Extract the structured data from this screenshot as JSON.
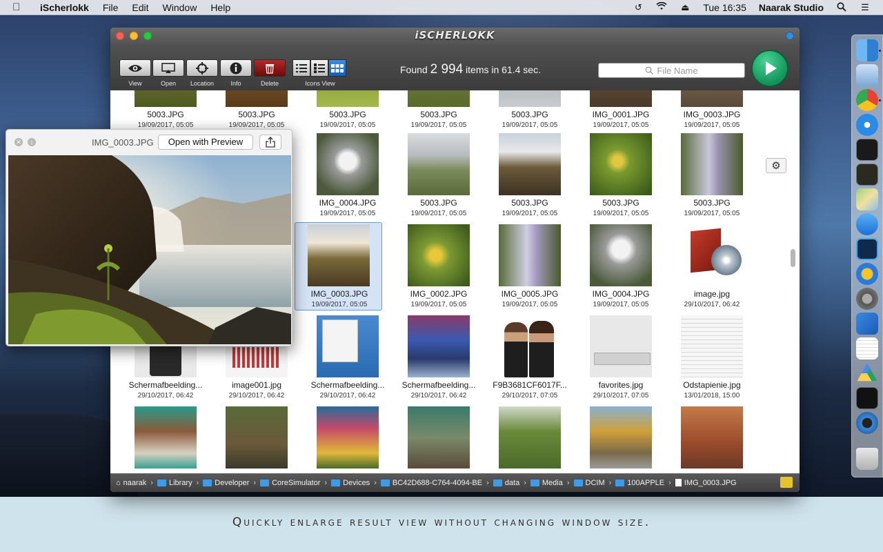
{
  "menubar": {
    "apple": "",
    "app_name": "iScherlokk",
    "items": [
      "File",
      "Edit",
      "Window",
      "Help"
    ],
    "clock": "Tue 16:35",
    "user": "Naarak Studio"
  },
  "window": {
    "logo": "iSCHERLOKK",
    "toolbar": {
      "view_label": "View",
      "open_label": "Open",
      "location_label": "Location",
      "info_label": "Info",
      "delete_label": "Delete",
      "icons_view_label": "Icons View"
    },
    "found_prefix": "Found",
    "found_count": "2 994",
    "found_suffix": "items in 61.4 sec.",
    "search_placeholder": "File Name"
  },
  "grid": {
    "row0": [
      {
        "name": "5003.JPG",
        "date": "19/09/2017, 05:05"
      },
      {
        "name": "5003.JPG",
        "date": "19/09/2017, 05:05"
      },
      {
        "name": "5003.JPG",
        "date": "19/09/2017, 05:05"
      },
      {
        "name": "5003.JPG",
        "date": "19/09/2017, 05:05"
      },
      {
        "name": "5003.JPG",
        "date": "19/09/2017, 05:05"
      },
      {
        "name": "IMG_0001.JPG",
        "date": "19/09/2017, 05:05"
      },
      {
        "name": "IMG_0003.JPG",
        "date": "19/09/2017, 05:05"
      }
    ],
    "row1": [
      {
        "name": "IMG_0004.JPG",
        "date": "19/09/2017, 05:05"
      },
      {
        "name": "5003.JPG",
        "date": "19/09/2017, 05:05"
      },
      {
        "name": "5003.JPG",
        "date": "19/09/2017, 05:05"
      },
      {
        "name": "5003.JPG",
        "date": "19/09/2017, 05:05"
      },
      {
        "name": "5003.JPG",
        "date": "19/09/2017, 05:05"
      }
    ],
    "row2": [
      {
        "name": "IMG_0003.JPG",
        "date": "19/09/2017, 05:05"
      },
      {
        "name": "IMG_0002.JPG",
        "date": "19/09/2017, 05:05"
      },
      {
        "name": "IMG_0005.JPG",
        "date": "19/09/2017, 05:05"
      },
      {
        "name": "IMG_0004.JPG",
        "date": "19/09/2017, 05:05"
      },
      {
        "name": "image.jpg",
        "date": "29/10/2017, 06:42"
      }
    ],
    "row3": [
      {
        "name": "Schermafbeelding...",
        "date": "29/10/2017, 06:42"
      },
      {
        "name": "image001.jpg",
        "date": "29/10/2017, 06:42"
      },
      {
        "name": "Schermafbeelding...",
        "date": "29/10/2017, 06:42"
      },
      {
        "name": "Schermafbeelding...",
        "date": "29/10/2017, 06:42"
      },
      {
        "name": "F9B3681CF6017F...",
        "date": "29/10/2017, 07:05"
      },
      {
        "name": "favorites.jpg",
        "date": "29/10/2017, 07:05"
      },
      {
        "name": "Odstapienie.jpg",
        "date": "13/01/2018, 15:00"
      }
    ]
  },
  "pathbar": [
    "naarak",
    "Library",
    "Developer",
    "CoreSimulator",
    "Devices",
    "BC42D688-C764-4094-BE",
    "data",
    "Media",
    "DCIM",
    "100APPLE",
    "IMG_0003.JPG"
  ],
  "preview": {
    "title": "IMG_0003.JPG",
    "open_button": "Open with Preview"
  },
  "caption": "Quickly enlarge result view without changing window size.",
  "dock": [
    "finder-icon",
    "preview-icon",
    "chrome-icon",
    "safari-icon",
    "terminal-icon",
    "console-icon",
    "maps-icon",
    "app-store-icon",
    "photoshop-icon",
    "keychain-icon",
    "system-preferences-icon",
    "xcode-icon",
    "textedit-icon",
    "google-drive-icon",
    "activity-monitor-icon",
    "quicktime-icon",
    "trash-icon"
  ]
}
